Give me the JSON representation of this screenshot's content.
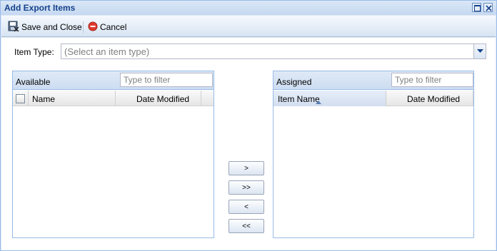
{
  "window": {
    "title": "Add Export Items"
  },
  "toolbar": {
    "save_label": "Save and Close",
    "cancel_label": "Cancel"
  },
  "item_type": {
    "label": "Item Type:",
    "placeholder": "(Select an item type)"
  },
  "available": {
    "title": "Available",
    "filter_placeholder": "Type to filter",
    "columns": [
      "Name",
      "Date Modified"
    ],
    "rows": []
  },
  "assigned": {
    "title": "Assigned",
    "filter_placeholder": "Type to filter",
    "columns": [
      "Item Name",
      "Date Modified"
    ],
    "sort": {
      "column": "Item Name",
      "direction": "ascending"
    },
    "rows": []
  },
  "move_buttons": {
    "add_one": ">",
    "add_all": ">>",
    "remove_one": "<",
    "remove_all": "<<"
  },
  "colors": {
    "accent": "#15428b",
    "panel_border": "#99bbe8",
    "cancel_icon": "#e03a2e"
  }
}
